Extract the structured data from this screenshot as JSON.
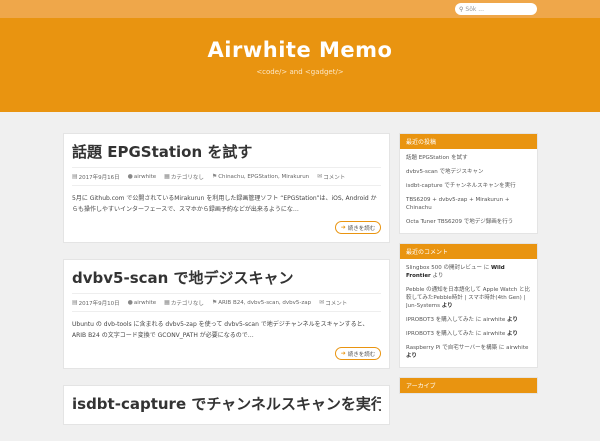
{
  "search": {
    "placeholder": "Sök ..."
  },
  "site": {
    "title": "Airwhite Memo",
    "description": "<code/> and <gadget/>"
  },
  "posts": [
    {
      "title": "話題 EPGStation を試す",
      "date": "2017年9月16日",
      "author": "airwhite",
      "category": "カテゴリなし",
      "tags": "Chinachu, EPGStation, Mirakurun",
      "comments": "コメント",
      "excerpt": "5月に Github.com で公開されているMirakurun を利用した録画管理ソフト “EPGStation”は、iOS, Android からも操作しやすいインターフェースで、スマホから録画予約などが出来るようにな…",
      "read_more": "続きを読む"
    },
    {
      "title": "dvbv5-scan で地デジスキャン",
      "date": "2017年9月10日",
      "author": "airwhite",
      "category": "カテゴリなし",
      "tags": "ARIB B24, dvbv5-scan, dvbv5-zap",
      "comments": "コメント",
      "excerpt": "Ubuntu の dvb-tools に含まれる dvbv5-zap を使って dvbv5-scan で地デジチャンネルをスキャンすると、ARIB B24 の文字コード変換で GCONV_PATH が必要になるので…",
      "read_more": "続きを読む"
    },
    {
      "title": "isdbt-capture でチャンネルスキャンを実行",
      "date": "",
      "author": "",
      "category": "",
      "tags": "",
      "comments": "",
      "excerpt": "",
      "read_more": ""
    }
  ],
  "sidebar": {
    "recent": {
      "title": "最近の投稿",
      "items": [
        "話題 EPGStation を試す",
        "dvbv5-scan で地デジスキャン",
        "isdbt-capture でチャンネルスキャンを実行",
        "TBS6209 + dvbv5-zap + Mirakurun + Chinachu",
        "Octa Tuner TBS6209 で地デジ録画を行う"
      ]
    },
    "comments": {
      "title": "最近のコメント",
      "items": [
        {
          "text": "Slingbox 500 の開封レビュー に ",
          "author": "Wild Frontier",
          "suffix": " より"
        },
        {
          "text": "Pebble の通知を日本語化して Apple Watch と比較してみたPebble時計 | スマホ時計(4th Gen) | Jun-Systems ",
          "author": "",
          "suffix": "より"
        },
        {
          "text": "IPROBOT3 を購入してみた に airwhite ",
          "author": "",
          "suffix": "より"
        },
        {
          "text": "IPROBOT3 を購入してみた に airwhite ",
          "author": "",
          "suffix": "より"
        },
        {
          "text": "Raspberry Pi で自宅サーバーを構築 に airwhite ",
          "author": "",
          "suffix": "より"
        }
      ]
    },
    "archive": {
      "title": "アーカイブ"
    }
  },
  "colors": {
    "accent": "#e99410",
    "topbar": "#efa74a",
    "background": "#f0f0f0"
  }
}
